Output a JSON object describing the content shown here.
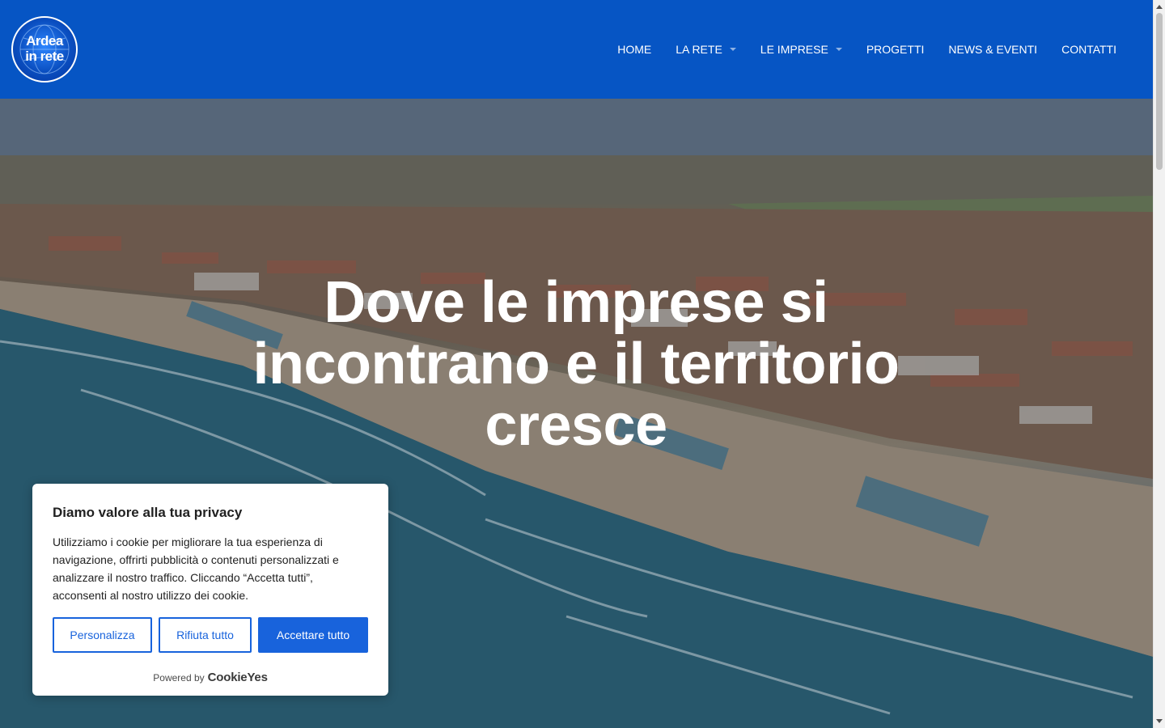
{
  "header": {
    "logo_text_line1": "Ardea",
    "logo_text_line2": "in rete",
    "nav": [
      {
        "label": "HOME",
        "has_dropdown": false
      },
      {
        "label": "LA RETE",
        "has_dropdown": true
      },
      {
        "label": "LE IMPRESE",
        "has_dropdown": true
      },
      {
        "label": "PROGETTI",
        "has_dropdown": false
      },
      {
        "label": "NEWS & EVENTI",
        "has_dropdown": false
      },
      {
        "label": "CONTATTI",
        "has_dropdown": false
      }
    ],
    "background_color": "#0655c4"
  },
  "hero": {
    "title": "Dove le imprese si incontrano e il territorio cresce",
    "image": "aerial-beach-town-photo"
  },
  "cookie_banner": {
    "title": "Diamo valore alla tua privacy",
    "text": "Utilizziamo i cookie per migliorare la tua esperienza di navigazione, offrirti pubblicità o contenuti personalizzati e analizzare il nostro traffico. Cliccando “Accetta tutti”, acconsenti al nostro utilizzo dei cookie.",
    "buttons": {
      "customize": "Personalizza",
      "reject": "Rifiuta tutto",
      "accept": "Accettare tutto"
    },
    "powered_by": "Powered by",
    "brand": "CookieYes",
    "accent_color": "#1863dc"
  }
}
